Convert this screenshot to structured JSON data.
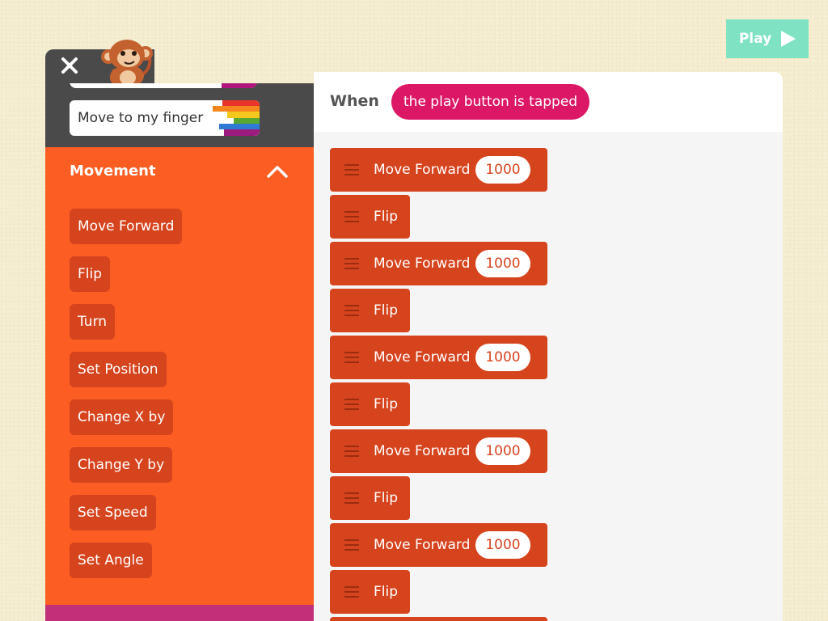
{
  "play_button": {
    "label": "Play"
  },
  "palette": {
    "finger_block": {
      "label": "Move to my finger"
    },
    "category": {
      "title": "Movement"
    },
    "blocks": [
      {
        "label": "Move Forward"
      },
      {
        "label": "Flip"
      },
      {
        "label": "Turn"
      },
      {
        "label": "Set Position"
      },
      {
        "label": "Change X by"
      },
      {
        "label": "Change Y by"
      },
      {
        "label": "Set Speed"
      },
      {
        "label": "Set Angle"
      }
    ]
  },
  "script": {
    "when_label": "When",
    "trigger": "the play button is tapped",
    "commands": [
      {
        "label": "Move Forward",
        "value": "1000"
      },
      {
        "label": "Flip"
      },
      {
        "label": "Move Forward",
        "value": "1000"
      },
      {
        "label": "Flip"
      },
      {
        "label": "Move Forward",
        "value": "1000"
      },
      {
        "label": "Flip"
      },
      {
        "label": "Move Forward",
        "value": "1000"
      },
      {
        "label": "Flip"
      },
      {
        "label": "Move Forward",
        "value": "1000"
      },
      {
        "label": "Flip"
      }
    ]
  },
  "colors": {
    "background": "#f5edcf",
    "play_button": "#7fe3c3",
    "palette_dark": "#4a4a4a",
    "movement_category": "#fb5d22",
    "movement_block": "#d6441e",
    "trigger_pill": "#dc1866"
  },
  "icons": [
    "close-icon",
    "monkey-character-icon",
    "chevron-up-icon",
    "play-icon",
    "drag-handle-icon"
  ]
}
